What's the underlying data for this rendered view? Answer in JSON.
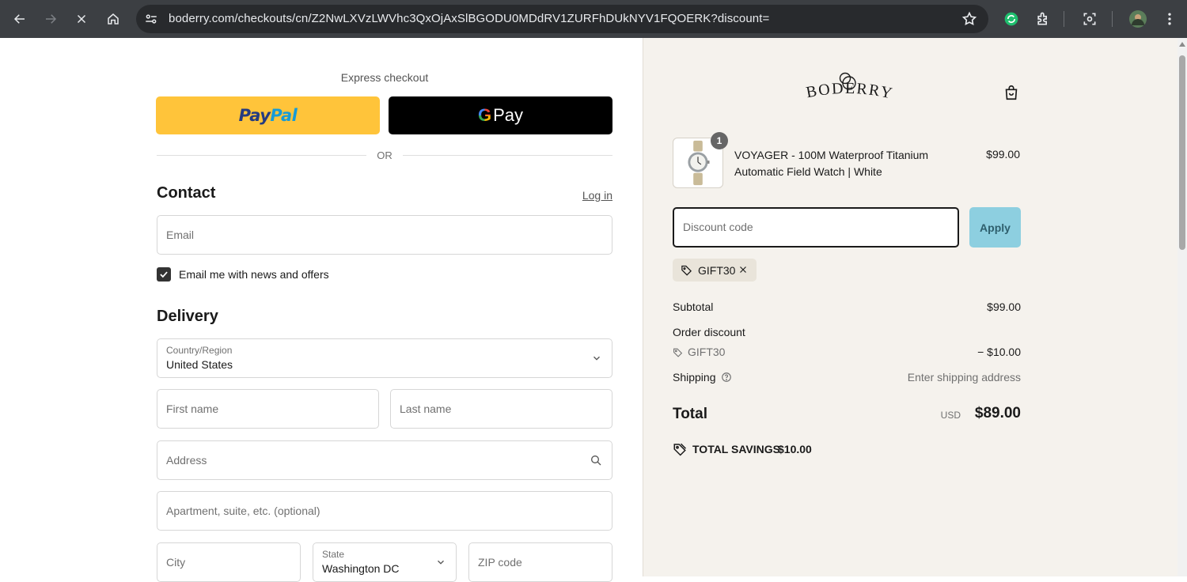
{
  "browser": {
    "url": "boderry.com/checkouts/cn/Z2NwLXVzLWVhc3QxOjAxSlBGODU0MDdRV1ZURFhDUkNYV1FQOERK?discount="
  },
  "express": {
    "label": "Express checkout",
    "paypal_part1": "Pay",
    "paypal_part2": "Pal",
    "gpay_g": "G",
    "gpay_label": "Pay",
    "or_label": "OR"
  },
  "contact": {
    "title": "Contact",
    "login_link": "Log in",
    "email_placeholder": "Email",
    "news_label": "Email me with news and offers",
    "news_checked": true
  },
  "delivery": {
    "title": "Delivery",
    "country_label": "Country/Region",
    "country_value": "United States",
    "first_name_placeholder": "First name",
    "last_name_placeholder": "Last name",
    "address_placeholder": "Address",
    "apartment_placeholder": "Apartment, suite, etc. (optional)",
    "city_placeholder": "City",
    "state_label": "State",
    "state_value": "Washington DC",
    "zip_placeholder": "ZIP code"
  },
  "summary": {
    "product": {
      "quantity": "1",
      "name": "VOYAGER - 100M Waterproof Titanium Automatic Field Watch | White",
      "price": "$99.00"
    },
    "discount_placeholder": "Discount code",
    "apply_label": "Apply",
    "applied_code": "GIFT30",
    "subtotal_label": "Subtotal",
    "subtotal_value": "$99.00",
    "order_discount_label": "Order discount",
    "discount_code": "GIFT30",
    "discount_value": "− $10.00",
    "shipping_label": "Shipping",
    "shipping_value": "Enter shipping address",
    "total_label": "Total",
    "total_currency": "USD",
    "total_value": "$89.00",
    "savings_label": "TOTAL SAVINGS",
    "savings_value": "$10.00"
  },
  "brand": {
    "logo_text": "BODERRY"
  },
  "colors": {
    "paypal_yellow": "#ffc43a",
    "gpay_black": "#000000",
    "summary_bg": "#f5f2ed",
    "apply_blue": "#8dcfe0",
    "chrome_dark": "#3c3f43"
  }
}
